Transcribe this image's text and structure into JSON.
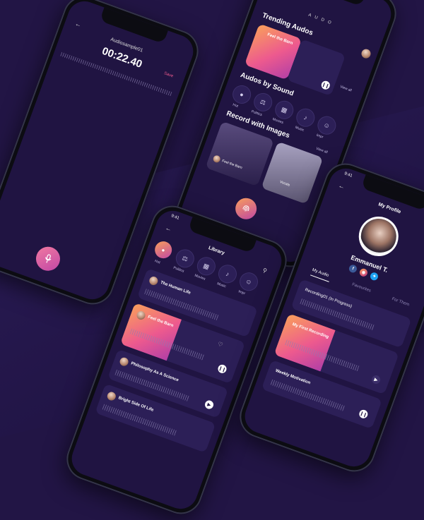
{
  "recorder": {
    "file_name": "Audiosample01",
    "timer": "00:22.40",
    "save_label": "Save",
    "back_icon": "arrow-left-icon",
    "mic_icon": "microphone-icon"
  },
  "home": {
    "brand": "A U D O",
    "trending_title": "Trending Audos",
    "featured_track": "Feel the Barn",
    "view_all": "View all",
    "by_sound_title": "Audos by Sound",
    "categories": [
      "Hot",
      "Politics",
      "Movies",
      "Music",
      "Impr"
    ],
    "images_title": "Record with Images",
    "images_view_all": "View all",
    "image_card_1": "Feel the Barn",
    "image_card_2": "Vocals"
  },
  "library": {
    "time": "9:41",
    "title": "Library",
    "categories": [
      "Hot",
      "Politics",
      "Movies",
      "Music",
      "Impr"
    ],
    "items": [
      {
        "title": "The Human Life"
      },
      {
        "title": "Feel the Barn"
      },
      {
        "title": "Philosophy As A Science"
      },
      {
        "title": "Bright Side Of Life"
      }
    ]
  },
  "profile": {
    "time": "9:41",
    "title": "My Profile",
    "name": "Emmanuel T.",
    "tabs": [
      "My Audio",
      "Favourites",
      "For Them"
    ],
    "items": [
      {
        "title": "Recording01 (In Progress)"
      },
      {
        "title": "My First Recording"
      },
      {
        "title": "Weekly Motivation"
      }
    ]
  },
  "colors": {
    "background": "#221545",
    "accent_pink": "#ed5a8e",
    "accent_orange": "#f9a05a"
  }
}
